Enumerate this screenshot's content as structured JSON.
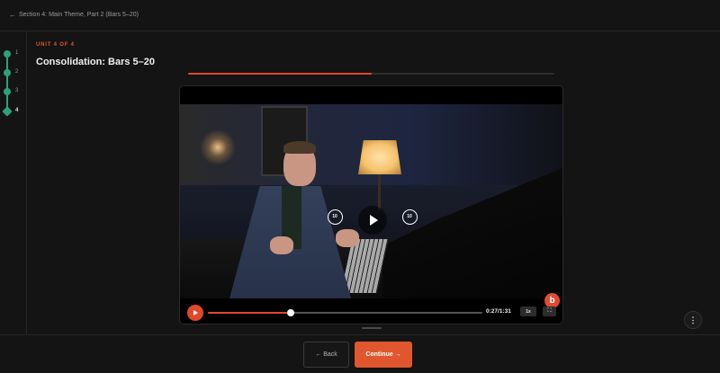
{
  "header": {
    "back_label": "Section 4: Main Theme, Part 2 (Bars 5–20)",
    "back_icon": "arrow-left-icon"
  },
  "steps": [
    {
      "label": "1",
      "state": "done"
    },
    {
      "label": "2",
      "state": "done"
    },
    {
      "label": "3",
      "state": "done"
    },
    {
      "label": "4",
      "state": "current"
    }
  ],
  "lesson": {
    "unit_label": "UNIT 4 OF 4",
    "title": "Consolidation: Bars 5–20",
    "progress_fraction": 0.5
  },
  "player": {
    "rewind_label": "10",
    "forward_label": "10",
    "time": "0:27/1:31",
    "played_fraction": 0.3,
    "speed": "1x",
    "brand_badge": "b",
    "fullscreen_icon": "fullscreen-icon",
    "play_icon": "play-icon"
  },
  "footer": {
    "back_label": "Back",
    "continue_label": "Continue"
  },
  "more_icon": "more-vertical-icon",
  "colors": {
    "accent": "#e0562f",
    "step_green": "#2fa07c",
    "background": "#141414"
  }
}
